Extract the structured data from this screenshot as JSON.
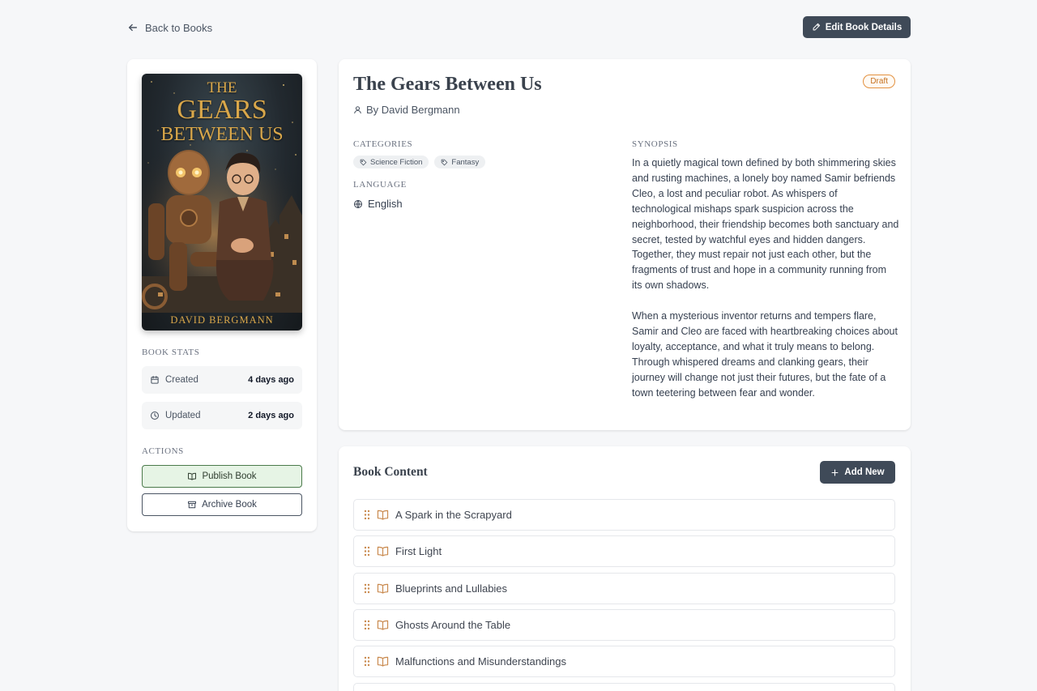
{
  "nav": {
    "back_label": "Back to Books",
    "edit_label": "Edit Book Details"
  },
  "cover": {
    "title_line1": "THE",
    "title_line2": "GEARS",
    "title_line3": "BETWEEN US",
    "author": "DAVID BERGMANN"
  },
  "stats": {
    "heading": "BOOK STATS",
    "created_label": "Created",
    "created_value": "4 days ago",
    "updated_label": "Updated",
    "updated_value": "2 days ago"
  },
  "actions": {
    "heading": "ACTIONS",
    "publish_label": "Publish Book",
    "archive_label": "Archive Book"
  },
  "book": {
    "title": "The Gears Between Us",
    "status": "Draft",
    "author_line": "By David Bergmann",
    "categories_heading": "CATEGORIES",
    "categories": [
      "Science Fiction",
      "Fantasy"
    ],
    "language_heading": "LANGUAGE",
    "language": "English",
    "synopsis_heading": "SYNOPSIS",
    "synopsis_p1": "In a quietly magical town defined by both shimmering skies and rusting machines, a lonely boy named Samir befriends Cleo, a lost and peculiar robot. As whispers of technological mishaps spark suspicion across the neighborhood, their friendship becomes both sanctuary and secret, tested by watchful eyes and hidden dangers. Together, they must repair not just each other, but the fragments of trust and hope in a community running from its own shadows.",
    "synopsis_p2": "When a mysterious inventor returns and tempers flare, Samir and Cleo are faced with heartbreaking choices about loyalty, acceptance, and what it truly means to belong. Through whispered dreams and clanking gears, their journey will change not just their futures, but the fate of a town teetering between fear and wonder."
  },
  "content": {
    "heading": "Book Content",
    "add_label": "Add New",
    "chapters": [
      "A Spark in the Scrapyard",
      "First Light",
      "Blueprints and Lullabies",
      "Ghosts Around the Table",
      "Malfunctions and Misunderstandings"
    ]
  },
  "colors": {
    "primary_button": "#3f4a58",
    "draft_badge": "#e3913f",
    "publish_bg": "#e6f4e5",
    "chapter_icon": "#c98a4f"
  },
  "icons": {
    "back": "arrow-left-icon",
    "edit": "pencil-icon",
    "author": "user-icon",
    "tag": "tag-icon",
    "language": "globe-icon",
    "created": "calendar-icon",
    "updated": "clock-icon",
    "publish": "book-open-icon",
    "archive": "archive-icon",
    "add": "plus-icon",
    "drag": "grip-icon",
    "chapter": "book-open-icon"
  }
}
